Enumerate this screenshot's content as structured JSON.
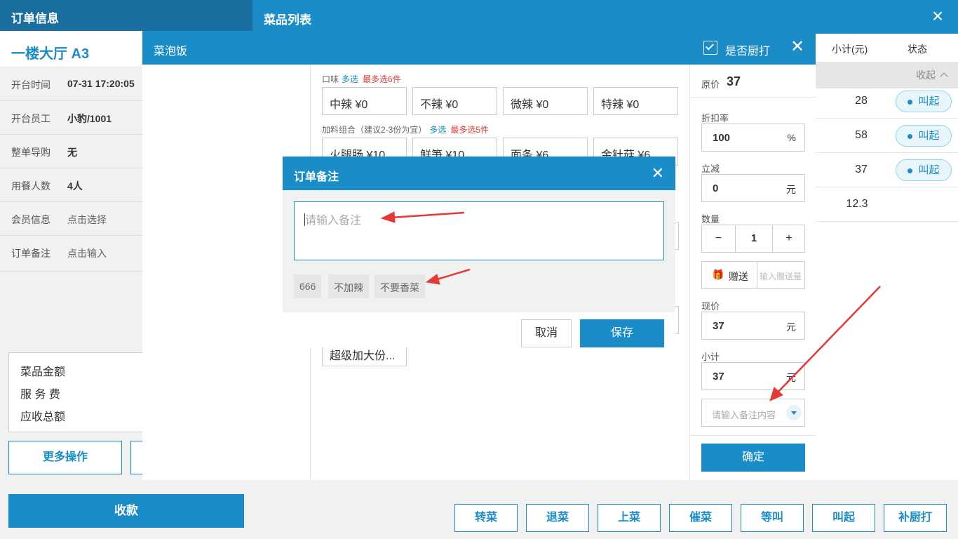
{
  "order": {
    "header_title": "订单信息",
    "table_name": "一楼大厅 A3",
    "rows": [
      {
        "label": "开台时间",
        "value": "07-31 17:20:05"
      },
      {
        "label": "开台员工",
        "value": "小豹/1001"
      },
      {
        "label": "整单导购",
        "value": "无"
      },
      {
        "label": "用餐人数",
        "value": "4人"
      },
      {
        "label": "会员信息",
        "value": "点击选择"
      },
      {
        "label": "订单备注",
        "value": "点击输入"
      }
    ],
    "summary": [
      "菜品金额",
      "服 务 费",
      "应收总额"
    ],
    "more_button": "更多操作",
    "pay_button": "收款"
  },
  "dish_list": {
    "title": "菜品列表",
    "close_icon": "×",
    "columns": [
      "小计(元)",
      "状态"
    ],
    "collapse": "收起",
    "rows": [
      {
        "amount": "28",
        "status": "叫起"
      },
      {
        "amount": "58",
        "status": "叫起"
      },
      {
        "amount": "37",
        "status": "叫起"
      },
      {
        "amount": "12.3",
        "status": ""
      }
    ]
  },
  "bottom_buttons": [
    "转菜",
    "退菜",
    "上菜",
    "催菜",
    "等叫",
    "叫起",
    "补厨打"
  ],
  "dish_detail": {
    "name": "菜泡饭",
    "kitchen_print_label": "是否厨打",
    "kitchen_print_checked": true,
    "taste": {
      "label": "口味",
      "multi": "多选",
      "max": "最多选6件",
      "options": [
        "中辣 ¥0",
        "不辣 ¥0",
        "微辣 ¥0",
        "特辣 ¥0"
      ]
    },
    "toppings": {
      "label": "加料组合（建议2-3份为宜）",
      "multi": "多选",
      "max": "最多选5件",
      "options": [
        "火腿肠 ¥10",
        "鲜笋 ¥10",
        "面条 ¥6",
        "金针菇 ¥6"
      ]
    },
    "extra_option": "超级加大份...",
    "original_price_label": "原价",
    "original_price": "37",
    "discount_label": "折扣率",
    "discount": "100",
    "discount_unit": "%",
    "reduce_label": "立减",
    "reduce": "0",
    "reduce_unit": "元",
    "qty_label": "数量",
    "qty": "1",
    "gift_label": "赠送",
    "gift_placeholder": "输入赠送量",
    "current_price_label": "现价",
    "current_price": "37",
    "current_unit": "元",
    "subtotal_label": "小计",
    "subtotal": "37",
    "subtotal_unit": "元",
    "remark_placeholder": "请输入备注内容",
    "confirm": "确定"
  },
  "remark_dialog": {
    "title": "订单备注",
    "placeholder": "请输入备注",
    "tags": [
      "666",
      "不加辣",
      "不要香菜"
    ],
    "cancel": "取消",
    "save": "保存"
  },
  "colors": {
    "primary": "#1a8cc8",
    "header_dark": "#1a6fa0",
    "warning": "#e53935"
  }
}
